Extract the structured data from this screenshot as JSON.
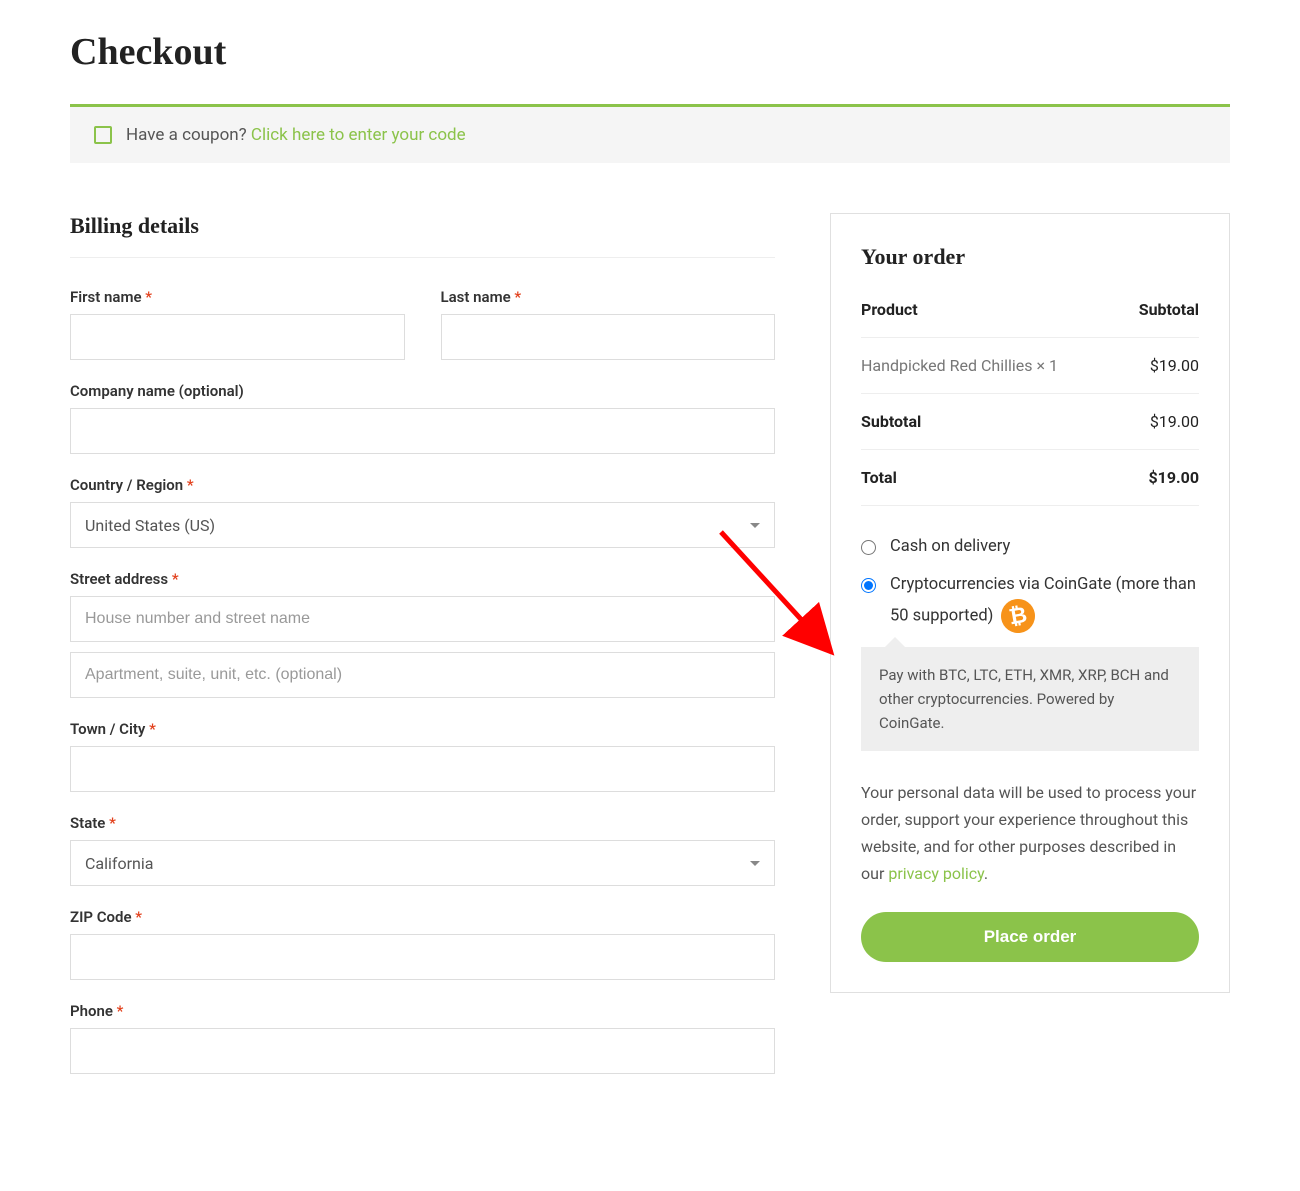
{
  "page": {
    "title": "Checkout"
  },
  "coupon": {
    "prompt": "Have a coupon? ",
    "link": "Click here to enter your code"
  },
  "billing": {
    "heading": "Billing details",
    "first_name_label": "First name",
    "last_name_label": "Last name",
    "company_label": "Company name (optional)",
    "country_label": "Country / Region",
    "country_value": "United States (US)",
    "street_label": "Street address",
    "street_placeholder": "House number and street name",
    "street2_placeholder": "Apartment, suite, unit, etc. (optional)",
    "city_label": "Town / City",
    "state_label": "State",
    "state_value": "California",
    "zip_label": "ZIP Code",
    "phone_label": "Phone"
  },
  "order": {
    "heading": "Your order",
    "product_header": "Product",
    "subtotal_header": "Subtotal",
    "line_item": "Handpicked Red Chillies  × 1",
    "line_price": "$19.00",
    "subtotal_label": "Subtotal",
    "subtotal_value": "$19.00",
    "total_label": "Total",
    "total_value": "$19.00"
  },
  "payment": {
    "cod_label": "Cash on delivery",
    "crypto_label": "Cryptocurrencies via CoinGate (more than 50 supported)",
    "crypto_desc": "Pay with BTC, LTC, ETH, XMR, XRP, BCH and other cryptocurrencies. Powered by CoinGate."
  },
  "privacy": {
    "text_before": "Your personal data will be used to process your order, support your experience throughout this website, and for other purposes described in our ",
    "link": "privacy policy",
    "text_after": "."
  },
  "actions": {
    "place_order": "Place order"
  },
  "required_marker": "*"
}
